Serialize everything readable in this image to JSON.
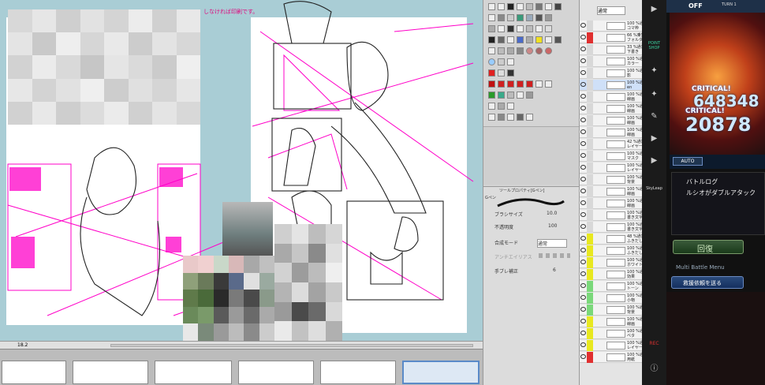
{
  "canvas": {
    "top_note": "しなければ印刷です。",
    "status_zoom": "18.2"
  },
  "tool_property": {
    "tab_title": "ツールプロパティ[Gペン]",
    "sub_title": "Gペン",
    "rows": [
      {
        "label": "ブラシサイズ",
        "value": "10.0"
      },
      {
        "label": "不透明度",
        "value": "100"
      },
      {
        "label": "合成モード",
        "value": "通常"
      },
      {
        "label": "アンチエイリアス",
        "value": ""
      },
      {
        "label": "手ブレ補正",
        "value": "6"
      }
    ]
  },
  "layers": {
    "blend_mode": "通常",
    "items": [
      {
        "label": "100 %通常\nコマ枠"
      },
      {
        "label": "66 %乗算\nフォルダー"
      },
      {
        "label": "33 %通常\n下書き"
      },
      {
        "label": "100 %通常\nカラー"
      },
      {
        "label": "100 %通常\n影"
      },
      {
        "label": "100 %通常\nen"
      },
      {
        "label": "100 %通常\n線画"
      },
      {
        "label": "100 %通常\n線画"
      },
      {
        "label": "100 %通常\n線画"
      },
      {
        "label": "100 %通常\n線画"
      },
      {
        "label": "42 %通常\nレイヤー"
      },
      {
        "label": "100 %通常\nマスク"
      },
      {
        "label": "100 %通常\nレイヤー"
      },
      {
        "label": "100 %通常\n背景"
      },
      {
        "label": "100 %通常\n線画"
      },
      {
        "label": "100 %通常\n線画"
      },
      {
        "label": "100 %通常\n書き文字"
      },
      {
        "label": "100 %通常\n書き文字"
      },
      {
        "label": "48 %通常\nふきだし"
      },
      {
        "label": "100 %通常\nふきだし"
      },
      {
        "label": "100 %通常\nホワイト"
      },
      {
        "label": "100 %通常\n効果"
      },
      {
        "label": "100 %通常\nトーン"
      },
      {
        "label": "100 %通常\n小物"
      },
      {
        "label": "100 %通常\n背景"
      },
      {
        "label": "100 %通常\n線画"
      },
      {
        "label": "100 %通常\nベタ"
      },
      {
        "label": "100 %通常\nレイヤー"
      },
      {
        "label": "100 %通常\n用紙"
      }
    ]
  },
  "sidebar": {
    "point_shop": "POINT SHOP",
    "skyleap": "SkyLeap",
    "rec": "REC"
  },
  "game": {
    "status": "OFF",
    "turn": "TURN 1",
    "critical_1": "CRITICAL!",
    "damage_1": "648348",
    "critical_2": "CRITICAL!",
    "damage_2": "20878",
    "auto": "AUTO",
    "battle_log_title": "バトルログ",
    "battle_log_text": "ルシオがダブルアタック",
    "heal_button": "回復",
    "multi_battle": "Multi Battle Menu",
    "rescue_button": "救援依頼を送る"
  }
}
